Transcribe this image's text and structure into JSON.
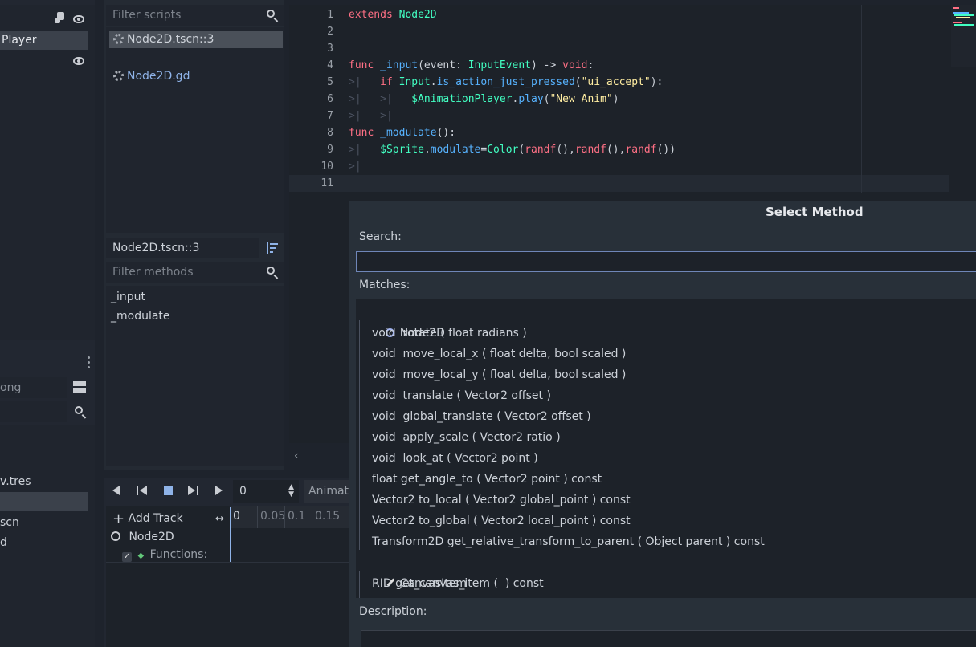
{
  "left_dock": {
    "selected_node": "Player",
    "filter_text": "ong",
    "files": [
      "v.tres",
      "scn",
      "d"
    ]
  },
  "scripts_panel": {
    "filter_placeholder": "Filter scripts",
    "scripts": [
      {
        "name": "Node2D.tscn::3",
        "selected": true
      },
      {
        "name": "Node2D.gd",
        "selected": false
      }
    ],
    "current_script": "Node2D.tscn::3",
    "methods_placeholder": "Filter methods",
    "methods": [
      "_input",
      "_modulate"
    ]
  },
  "editor": {
    "line_numbers": [
      "1",
      "2",
      "3",
      "4",
      "5",
      "6",
      "7",
      "8",
      "9",
      "10",
      "11"
    ]
  },
  "animation": {
    "time_value": "0",
    "anim_label": "Animati",
    "add_track_label": "Add Track",
    "ticks": [
      "0",
      "0.05",
      "0.1",
      "0.15"
    ],
    "node_label": "Node2D",
    "functions_label": "Functions:"
  },
  "dialog": {
    "title": "Select Method",
    "search_label": "Search:",
    "search_value": "",
    "matches_label": "Matches:",
    "description_label": "Description:",
    "matches": [
      {
        "text": "Node2D",
        "kind": "class",
        "icon": "node-icon"
      },
      {
        "text": "void  rotate ( float radians )",
        "kind": "method"
      },
      {
        "text": "void  move_local_x ( float delta, bool scaled )",
        "kind": "method"
      },
      {
        "text": "void  move_local_y ( float delta, bool scaled )",
        "kind": "method"
      },
      {
        "text": "void  translate ( Vector2 offset )",
        "kind": "method"
      },
      {
        "text": "void  global_translate ( Vector2 offset )",
        "kind": "method"
      },
      {
        "text": "void  apply_scale ( Vector2 ratio )",
        "kind": "method"
      },
      {
        "text": "void  look_at ( Vector2 point )",
        "kind": "method"
      },
      {
        "text": "float get_angle_to ( Vector2 point ) const",
        "kind": "method"
      },
      {
        "text": "Vector2 to_local ( Vector2 global_point ) const",
        "kind": "method"
      },
      {
        "text": "Vector2 to_global ( Vector2 local_point ) const",
        "kind": "method"
      },
      {
        "text": "Transform2D get_relative_transform_to_parent ( Object parent ) const",
        "kind": "method"
      },
      {
        "text": "CanvasItem",
        "kind": "class",
        "icon": "brush-icon"
      },
      {
        "text": "RID get_canvas_item (  ) const",
        "kind": "method"
      }
    ]
  },
  "colors": {
    "keyword": "#ff7085",
    "type": "#42ffc2",
    "function": "#57b3ff",
    "string": "#ffeda1",
    "accent": "#a5b7f3"
  }
}
